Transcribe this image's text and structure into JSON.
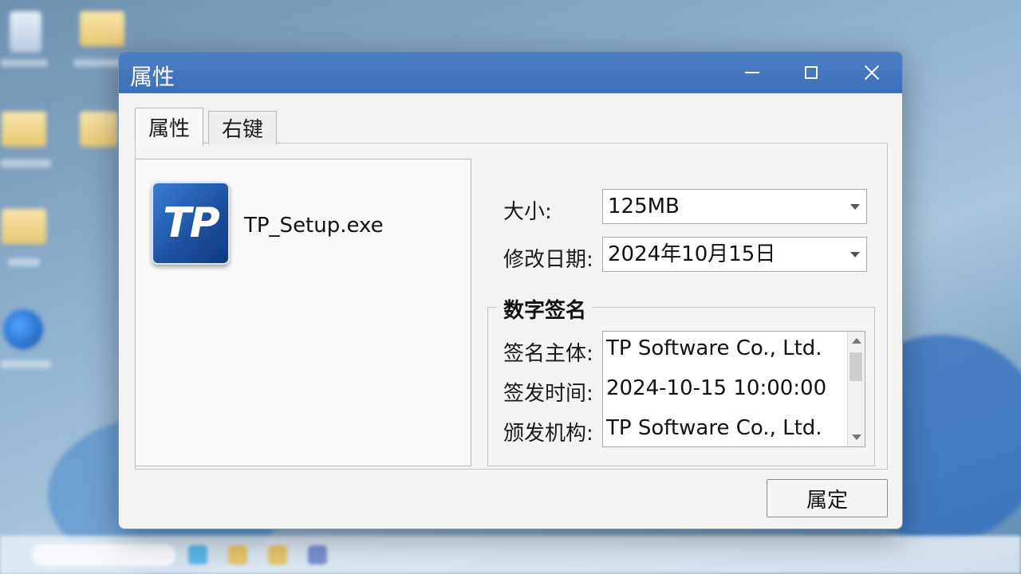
{
  "window": {
    "title": "属性",
    "controls": [
      "minimize",
      "maximize",
      "close"
    ]
  },
  "tabs": [
    {
      "label": "属性",
      "active": true
    },
    {
      "label": "右键",
      "active": false
    }
  ],
  "file": {
    "icon_text": "TP",
    "name": "TP_Setup.exe"
  },
  "fields": {
    "size_label": "大小:",
    "size_value": "125MB",
    "modified_label": "修改日期:",
    "modified_value": "2024年10月15日"
  },
  "signature": {
    "title": "数字签名",
    "rows": [
      {
        "label": "签名主体:",
        "value": "TP Software Co., Ltd."
      },
      {
        "label": "签发时间:",
        "value": "2024-10-15 10:00:00"
      },
      {
        "label": "颁发机构:",
        "value": "TP Software Co., Ltd."
      }
    ]
  },
  "ok_button": "属定",
  "colors": {
    "titlebar": "#3c6fb6",
    "dialog_bg": "#f3f3f1",
    "icon_blue": "#1c4f9e"
  }
}
